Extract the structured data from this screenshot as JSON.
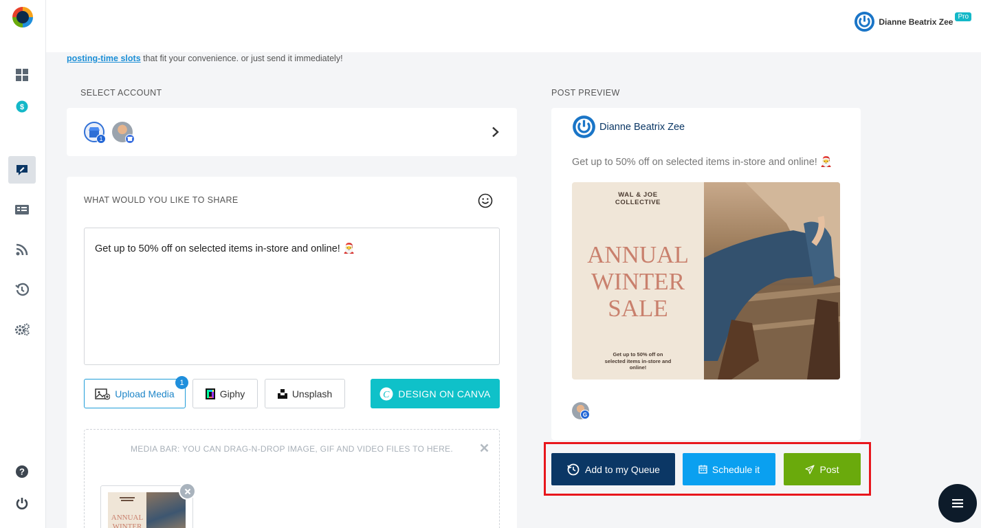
{
  "header": {
    "user_name": "Dianne Beatrix Zee",
    "pro_label": "Pro"
  },
  "intro": {
    "link_text": "posting-time slots",
    "rest_text": " that fit your convenience. or just send it immediately!"
  },
  "select_account": {
    "label": "SELECT ACCOUNT",
    "badge_count": "1"
  },
  "compose": {
    "label": "WHAT WOULD YOU LIKE TO SHARE",
    "text": "Get up to 50% off on selected items in-store and online! 🎅",
    "upload_label": "Upload Media",
    "upload_count": "1",
    "giphy_label": "Giphy",
    "unsplash_label": "Unsplash",
    "canva_label": "DESIGN ON CANVA",
    "media_hint": "MEDIA BAR: YOU CAN DRAG-N-DROP IMAGE, GIF AND VIDEO FILES TO HERE."
  },
  "preview": {
    "label": "POST PREVIEW",
    "author": "Dianne Beatrix Zee",
    "text": "Get up to 50% off on selected items in-store and online! 🎅",
    "image": {
      "brand": "WAL & JOE\nCOLLECTIVE",
      "headline_1": "ANNUAL",
      "headline_2": "WINTER",
      "headline_3": "SALE",
      "caption": "Get up to 50% off on\nselected items in-store and\nonline!"
    }
  },
  "actions": {
    "queue_label": "Add to my Queue",
    "schedule_label": "Schedule it",
    "post_label": "Post"
  },
  "colors": {
    "brand_teal": "#0fc1c9",
    "queue_navy": "#0b3765",
    "schedule_blue": "#0aa0f0",
    "post_green": "#6aaa0c",
    "highlight_red": "#e8161c"
  }
}
